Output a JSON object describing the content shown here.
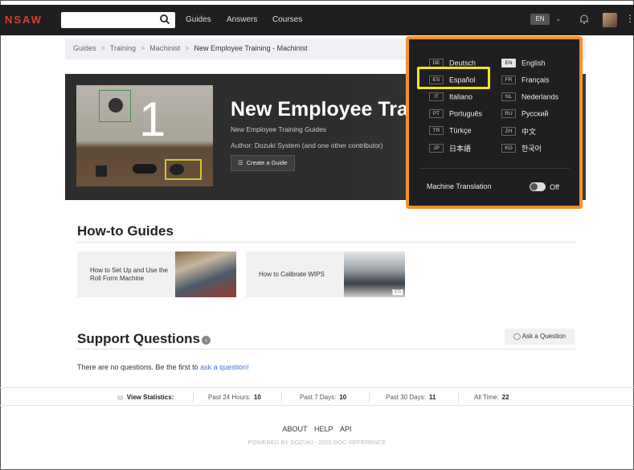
{
  "nav": {
    "logo": "NSAW",
    "links": [
      "Guides",
      "Answers",
      "Courses"
    ],
    "lang_badge": "EN",
    "more_glyph": "⋮"
  },
  "breadcrumb": {
    "items": [
      "Guides",
      "Training",
      "Machinist"
    ],
    "current": "New Employee Training - Machinist",
    "separator": ">"
  },
  "hero": {
    "title": "New Employee Train",
    "subtitle": "New Employee Training Guides",
    "author": "Author: Dozuki System (and one other contributor)",
    "create_button": "Create a Guide",
    "image_number": "1"
  },
  "howto": {
    "heading": "How-to Guides",
    "cards": [
      {
        "title": "How to Set Up and Use the Roll Form Machine"
      },
      {
        "title": "How to Calibrate WIPS",
        "tag": "ES"
      }
    ]
  },
  "support": {
    "heading": "Support Questions",
    "ask_button": "Ask a Question",
    "empty_text": "There are no questions. Be the first to ",
    "empty_link": "ask a question!"
  },
  "stats": {
    "label": "View Statistics:",
    "items": [
      {
        "label": "Past 24 Hours:",
        "value": "10"
      },
      {
        "label": "Past 7 Days:",
        "value": "10"
      },
      {
        "label": "Past 30 Days:",
        "value": "11"
      },
      {
        "label": "All Time:",
        "value": "22"
      }
    ]
  },
  "footer": {
    "links": [
      "ABOUT",
      "HELP",
      "API"
    ],
    "powered": "POWERED BY DOZUKI - 2020 DOC-REFERENCE"
  },
  "language_menu": {
    "languages": [
      {
        "code": "DE",
        "name": "Deutsch"
      },
      {
        "code": "EN",
        "name": "English",
        "selected": true
      },
      {
        "code": "ES",
        "name": "Español",
        "highlighted": true
      },
      {
        "code": "FR",
        "name": "Français"
      },
      {
        "code": "IT",
        "name": "Italiano"
      },
      {
        "code": "NL",
        "name": "Nederlands"
      },
      {
        "code": "PT",
        "name": "Português"
      },
      {
        "code": "RU",
        "name": "Русский"
      },
      {
        "code": "TR",
        "name": "Türkçe"
      },
      {
        "code": "ZH",
        "name": "中文"
      },
      {
        "code": "JP",
        "name": "日本語"
      },
      {
        "code": "KO",
        "name": "한국어"
      }
    ],
    "machine_translation_label": "Machine Translation",
    "machine_translation_state": "Off"
  },
  "colors": {
    "annotation_orange": "#f0932b",
    "annotation_yellow": "#f2e420",
    "link_blue": "#3a7bd5",
    "nav_dark": "#1f1f21"
  }
}
